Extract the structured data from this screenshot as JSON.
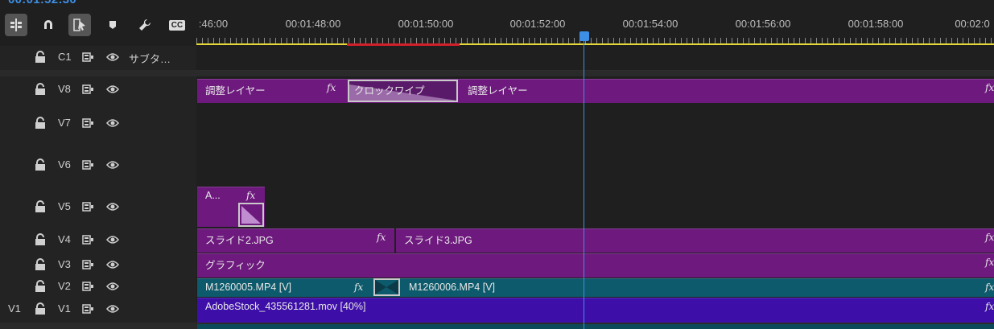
{
  "timecode": "00:01:52:30",
  "toolbar": {
    "buttons": [
      "insert-overwrite-icon",
      "snap-magnet-icon",
      "linked-selection-icon",
      "marker-icon",
      "wrench-icon",
      "captions-icon"
    ],
    "cc_label": "CC"
  },
  "ruler": {
    "labels": [
      ":46:00",
      "00:01:48:00",
      "00:01:50:00",
      "00:01:52:00",
      "00:01:54:00",
      "00:01:56:00",
      "00:01:58:00",
      "00:02:0"
    ]
  },
  "tracks": {
    "c1": {
      "name": "C1",
      "extra": "サブタ…"
    },
    "v8": {
      "name": "V8"
    },
    "v7": {
      "name": "V7"
    },
    "v6": {
      "name": "V6"
    },
    "v5": {
      "name": "V5"
    },
    "v4": {
      "name": "V4"
    },
    "v3": {
      "name": "V3"
    },
    "v2": {
      "name": "V2"
    },
    "v1": {
      "name": "V1",
      "source": "V1"
    }
  },
  "clips": {
    "v8_a": {
      "label": "調整レイヤー",
      "fx": "fx"
    },
    "v8_trans": {
      "label": "クロックワイプ"
    },
    "v8_b": {
      "label": "調整レイヤー",
      "fx": "fx"
    },
    "v5_a": {
      "label": "A...",
      "fx": "fx"
    },
    "v4_a": {
      "label": "スライド2.JPG",
      "fx": "fx"
    },
    "v4_b": {
      "label": "スライド3.JPG",
      "fx": "fx"
    },
    "v3_a": {
      "label": "グラフィック",
      "fx": "fx"
    },
    "v2_a": {
      "label": "M1260005.MP4 [V]",
      "fx": "fx"
    },
    "v2_b": {
      "label": "M1260006.MP4 [V]",
      "fx": "fx"
    },
    "v1_a": {
      "label": "AdobeStock_435561281.mov [40%]",
      "fx": "fx"
    }
  },
  "colors": {
    "playhead": "#3d8fe6",
    "adjustment_clip": "#6e197e",
    "video_clip": "#0c5a6b",
    "v1_clip": "#3d0fa8",
    "work_area": "#e6d83a",
    "render_bar": "#d0202a"
  }
}
